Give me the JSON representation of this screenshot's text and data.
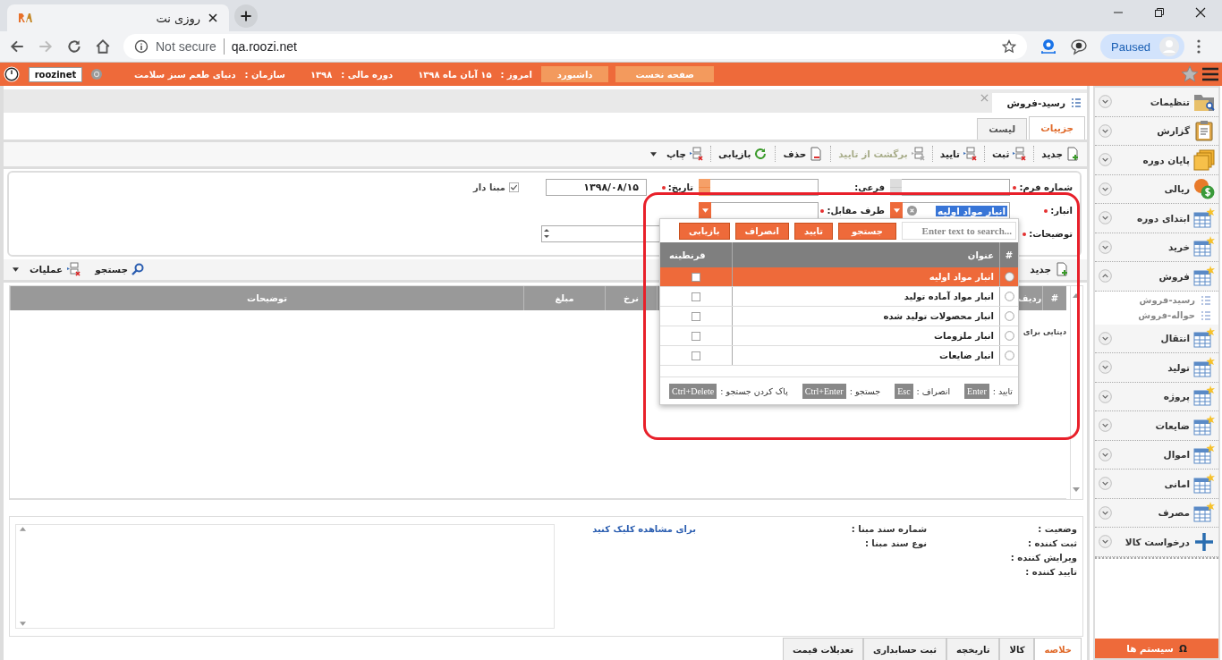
{
  "browser": {
    "tab_title": "روزی نت",
    "security": "Not secure",
    "url": "qa.roozi.net",
    "profile_status": "Paused"
  },
  "header": {
    "buttons": [
      "صفحه نخست",
      "داشبورد"
    ],
    "info": [
      {
        "label": "امروز :",
        "value": "۱۵ آبان ماه ۱۳۹۸"
      },
      {
        "label": "دوره مالی :",
        "value": "۱۳۹۸"
      },
      {
        "label": "سازمان :",
        "value": "دنیای طعم سبز سلامت"
      }
    ],
    "user": "roozinet"
  },
  "document_tab": {
    "title": "رسید-فروش"
  },
  "view_tabs": [
    {
      "label": "جزییات",
      "selected": true
    },
    {
      "label": "لیست",
      "selected": false
    }
  ],
  "toolbar": [
    {
      "kind": "new",
      "label": "جدید",
      "disabled": false
    },
    {
      "kind": "register",
      "label": "ثبت",
      "disabled": false
    },
    {
      "kind": "approve",
      "label": "تایید",
      "disabled": false
    },
    {
      "kind": "revert",
      "label": "برگشت از تایید",
      "disabled": true
    },
    {
      "kind": "delete",
      "label": "حذف",
      "disabled": false
    },
    {
      "kind": "restore",
      "label": "بازیابی",
      "disabled": false
    },
    {
      "kind": "print",
      "label": "چاپ",
      "disabled": false
    }
  ],
  "form": {
    "form_number": {
      "label": "شماره فرم:",
      "required": true
    },
    "sub": {
      "label": "فرعی:"
    },
    "date": {
      "label": "تاریخ:",
      "required": true,
      "value": "۱۳۹۸/۰۸/۱۵"
    },
    "based": {
      "label": "مبنا دار",
      "checked": true
    },
    "warehouse": {
      "label": "انبار:",
      "required": true,
      "value": "انبار مواد اولیه"
    },
    "counterparty": {
      "label": "طرف مقابل:",
      "required": true
    },
    "description": {
      "label": "توضیحات:",
      "required": true
    }
  },
  "grid_toolbar": {
    "new": "جدید",
    "search": "جستجو",
    "operations": "عملیات"
  },
  "grid": {
    "columns": [
      "#",
      "ردیف",
      "نرخ",
      "مبلغ",
      "توضیحات"
    ],
    "empty_text": "دیتایی برای"
  },
  "lookup": {
    "placeholder": "Enter text to search...",
    "buttons": [
      "جستجو",
      "تایید",
      "انصراف",
      "بازیابی"
    ],
    "columns": [
      "#",
      "عنوان",
      "قرنطینه"
    ],
    "rows": [
      {
        "title": "انبار مواد اولیه",
        "selected": true,
        "checked": false
      },
      {
        "title": "انبار مواد آماده تولید",
        "selected": false,
        "checked": false
      },
      {
        "title": "انبار محصولات تولید شده",
        "selected": false,
        "checked": false
      },
      {
        "title": "انبار ملزومات",
        "selected": false,
        "checked": false
      },
      {
        "title": "انبار ضایعات",
        "selected": false,
        "checked": false
      }
    ],
    "shortcuts": [
      {
        "label": "تایید :",
        "key": "Enter"
      },
      {
        "label": "انصراف :",
        "key": "Esc"
      },
      {
        "label": "جستجو :",
        "key": "Ctrl+Enter"
      },
      {
        "label": "پاک کردن جستجو :",
        "key": "Ctrl+Delete"
      }
    ]
  },
  "details": {
    "fields": [
      "وضعیت :",
      "ثبت کننده :",
      "ویرایش کننده :",
      "تایید کننده :"
    ],
    "base_fields": [
      "شماره سند مبنا :",
      "نوع سند مبنا :"
    ],
    "link": "برای مشاهده کلیک کنید"
  },
  "bottom_tabs": [
    {
      "label": "خلاصه",
      "selected": true
    },
    {
      "label": "کالا",
      "selected": false
    },
    {
      "label": "تاریخچه",
      "selected": false
    },
    {
      "label": "ثبت حسابداری",
      "selected": false
    },
    {
      "label": "تعدیلات قیمت",
      "selected": false
    }
  ],
  "sidebar": {
    "items": [
      {
        "label": "تنظیمات",
        "expanded": false
      },
      {
        "label": "گزارش",
        "expanded": false
      },
      {
        "label": "پایان دوره",
        "expanded": false
      },
      {
        "label": "ریالی",
        "expanded": false
      },
      {
        "label": "ابتدای دوره",
        "expanded": false
      },
      {
        "label": "خرید",
        "expanded": false
      },
      {
        "label": "فروش",
        "expanded": true,
        "children": [
          "رسید-فروش",
          "حواله-فروش"
        ]
      },
      {
        "label": "انتقال",
        "expanded": false
      },
      {
        "label": "تولید",
        "expanded": false
      },
      {
        "label": "پروژه",
        "expanded": false
      },
      {
        "label": "ضایعات",
        "expanded": false
      },
      {
        "label": "اموال",
        "expanded": false
      },
      {
        "label": "امانی",
        "expanded": false
      },
      {
        "label": "مصرف",
        "expanded": false
      },
      {
        "label": "درخواست کالا",
        "expanded": false
      }
    ],
    "system_button": {
      "symbol": "Ω",
      "label": "سیستم ها"
    }
  }
}
